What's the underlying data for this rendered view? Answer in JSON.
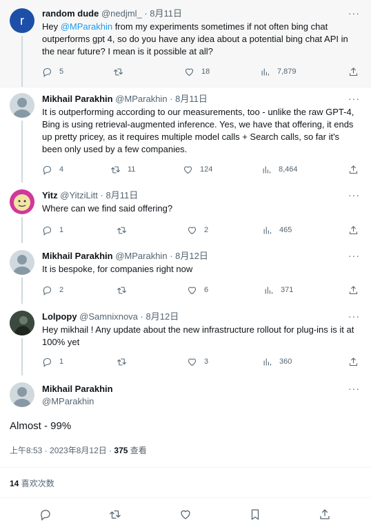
{
  "replies": [
    {
      "name": "random dude",
      "handle": "@nedjml_",
      "date": "8月11日",
      "text_before": "Hey ",
      "mention": "@MParakhin",
      "text_after": " from my experiments sometimes if not often bing chat outperforms gpt 4, so do you have any idea about a potential bing chat API in the near future? I mean is it possible at all?",
      "reply_count": "5",
      "retweet_count": "",
      "like_count": "18",
      "view_count": "7,879",
      "avatar_letter": "r",
      "avatar_color": "#1d4fa8"
    },
    {
      "name": "Mikhail Parakhin",
      "handle": "@MParakhin",
      "date": "8月11日",
      "text": "It is outperforming according to our measurements, too - unlike the raw GPT-4, Bing is using retrieval-augmented inference. Yes, we have that offering, it ends up pretty pricey, as it requires multiple model calls + Search calls, so far it's been only used by a few companies.",
      "reply_count": "4",
      "retweet_count": "11",
      "like_count": "124",
      "view_count": "8,464"
    },
    {
      "name": "Yitz",
      "handle": "@YitziLitt",
      "date": "8月11日",
      "text": "Where can we find said offering?",
      "reply_count": "1",
      "retweet_count": "",
      "like_count": "2",
      "view_count": "465"
    },
    {
      "name": "Mikhail Parakhin",
      "handle": "@MParakhin",
      "date": "8月12日",
      "text": "It is bespoke, for companies right now",
      "reply_count": "2",
      "retweet_count": "",
      "like_count": "6",
      "view_count": "371"
    },
    {
      "name": "Lolpopy",
      "handle": "@Samnixnova",
      "date": "8月12日",
      "text": "Hey mikhail ! Any update about the new infrastructure rollout for plug-ins is it at 100% yet",
      "reply_count": "1",
      "retweet_count": "",
      "like_count": "3",
      "view_count": "360"
    }
  ],
  "main_tweet": {
    "name": "Mikhail Parakhin",
    "handle": "@MParakhin",
    "text": "Almost - 99%",
    "time": "上午8:53 · 2023年8月12日 · ",
    "views_count": "375",
    "views_label": " 查看",
    "likes_count": "14",
    "likes_label": " 喜欢次数"
  },
  "dot": "·",
  "more_label": "···",
  "colors": {
    "accent": "#1d9bf0",
    "muted": "#536471",
    "text": "#0f1419"
  }
}
